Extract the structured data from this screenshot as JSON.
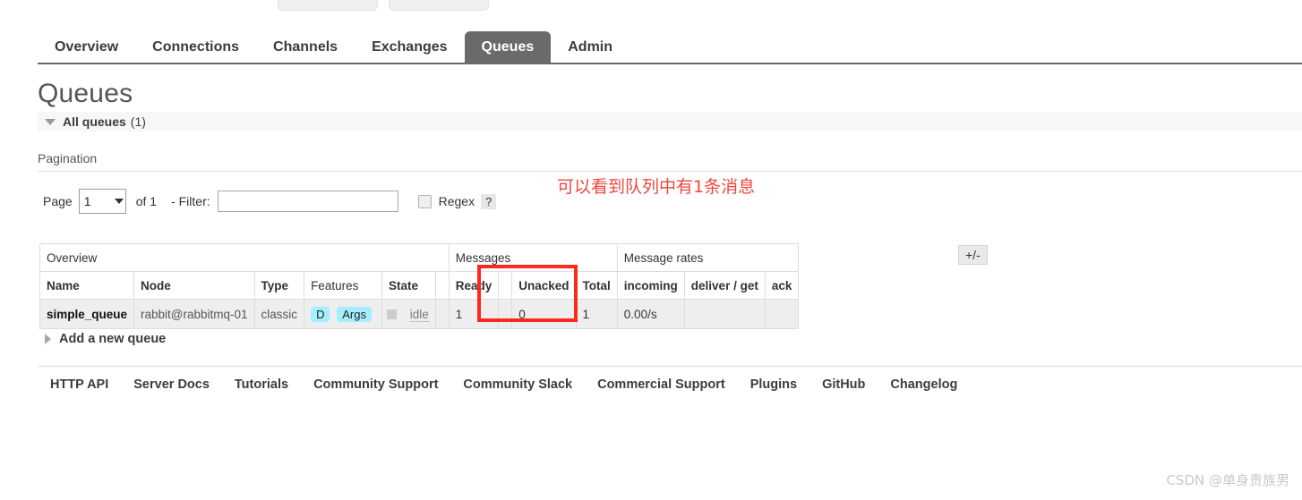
{
  "nav": {
    "tabs": [
      {
        "label": "Overview",
        "active": false
      },
      {
        "label": "Connections",
        "active": false
      },
      {
        "label": "Channels",
        "active": false
      },
      {
        "label": "Exchanges",
        "active": false
      },
      {
        "label": "Queues",
        "active": true
      },
      {
        "label": "Admin",
        "active": false
      }
    ]
  },
  "page": {
    "title": "Queues",
    "section": {
      "label": "All queues",
      "count": "(1)"
    },
    "pagination_heading": "Pagination"
  },
  "pagination": {
    "page_label": "Page",
    "page_value": "1",
    "of_label": "of 1",
    "filter_label": "- Filter:",
    "filter_value": "",
    "filter_placeholder": "",
    "regex_label": "Regex",
    "help_label": "?"
  },
  "annotation": {
    "text": "可以看到队列中有1条消息",
    "color": "#f1453d"
  },
  "table": {
    "toggle_label": "+/-",
    "group_headers": [
      {
        "label": "Overview",
        "span": 6
      },
      {
        "label": "Messages",
        "span": 4
      },
      {
        "label": "Message rates",
        "span": 3
      }
    ],
    "columns": [
      {
        "label": "Name",
        "bold": true,
        "align": "left"
      },
      {
        "label": "Node",
        "bold": true,
        "align": "left"
      },
      {
        "label": "Type",
        "bold": true,
        "align": "left"
      },
      {
        "label": "Features",
        "bold": false,
        "align": "left"
      },
      {
        "label": "State",
        "bold": true,
        "align": "left"
      },
      {
        "label": "Ready",
        "bold": true,
        "align": "right"
      },
      {
        "label": "Unacked",
        "bold": true,
        "align": "right"
      },
      {
        "label": "Total",
        "bold": true,
        "align": "right"
      },
      {
        "label": "incoming",
        "bold": true,
        "align": "right"
      },
      {
        "label": "deliver / get",
        "bold": true,
        "align": "left"
      },
      {
        "label": "ack",
        "bold": true,
        "align": "left"
      }
    ],
    "rows": [
      {
        "name": "simple_queue",
        "node": "rabbit@rabbitmq-01",
        "type": "classic",
        "features": [
          "D",
          "Args"
        ],
        "state": "idle",
        "ready": "1",
        "unacked": "0",
        "total": "1",
        "incoming": "0.00/s",
        "deliver_get": "",
        "ack": ""
      }
    ]
  },
  "add_queue": {
    "label": "Add a new queue"
  },
  "footer": {
    "links": [
      "HTTP API",
      "Server Docs",
      "Tutorials",
      "Community Support",
      "Community Slack",
      "Commercial Support",
      "Plugins",
      "GitHub",
      "Changelog"
    ]
  },
  "watermark": {
    "text": "CSDN @单身贵族男"
  }
}
